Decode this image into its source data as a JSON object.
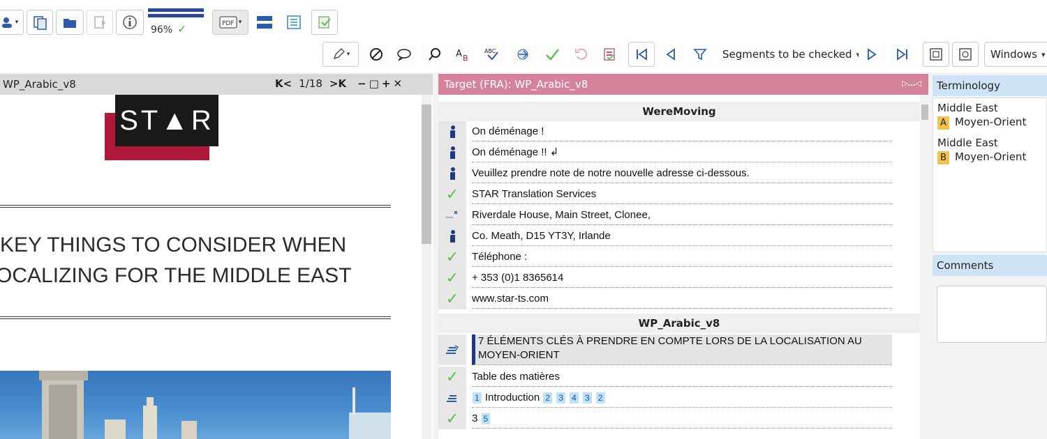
{
  "toolbar1": {
    "zoom_value": "96%"
  },
  "toolbar2": {
    "segments_filter_label": "Segments to be checked",
    "windows_label": "Windows"
  },
  "left_pane": {
    "title": "WP_Arabic_v8",
    "page_indicator": "1/18",
    "logo_text": "ST▲R",
    "heading_line1": "KEY THINGS TO CONSIDER WHEN",
    "heading_line2": "OCALIZING FOR THE MIDDLE EAST"
  },
  "target_pane": {
    "title": "Target (FRA): WP_Arabic_v8",
    "group1_title": "WereMoving",
    "group2_title": "WP_Arabic_v8",
    "segments_group1": [
      {
        "status": "person",
        "text": "On déménage !"
      },
      {
        "status": "person",
        "text": "On déménage !! ↲"
      },
      {
        "status": "person",
        "text": "Veuillez prendre note de notre nouvelle adresse ci-dessous."
      },
      {
        "status": "check",
        "text": "STAR Translation Services"
      },
      {
        "status": "partial",
        "text": "Riverdale House, Main Street, Clonee,"
      },
      {
        "status": "person",
        "text": "Co. Meath, D15 YT3Y, Irlande"
      },
      {
        "status": "check",
        "text": "Téléphone :"
      },
      {
        "status": "check",
        "text": "+ 353 (0)1 8365614"
      },
      {
        "status": "check",
        "text": "www.star-ts.com"
      }
    ],
    "segments_group2": [
      {
        "status": "edit",
        "text": "7 ÉLÉMENTS CLÉS À PRENDRE EN COMPTE LORS DE LA LOCALISATION AU MOYEN-ORIENT"
      },
      {
        "status": "check",
        "text": "Table des matières"
      },
      {
        "status": "edit",
        "text": "Introduction"
      },
      {
        "status": "check",
        "text": "3"
      }
    ],
    "tags_row3": [
      "1",
      "2",
      "3",
      "4",
      "3",
      "2"
    ],
    "tag_row4": "5"
  },
  "terminology": {
    "title": "Terminology",
    "entries": [
      {
        "source": "Middle East",
        "badge": "A",
        "target": "Moyen-Orient"
      },
      {
        "source": "Middle East",
        "badge": "B",
        "target": "Moyen-Orient"
      }
    ]
  },
  "comments": {
    "title": "Comments"
  },
  "colors": {
    "target_header": "#d4839a",
    "panel_header": "#cfe3f6",
    "check_green": "#5fbf49",
    "active_segment_bar": "#1f3a80"
  }
}
